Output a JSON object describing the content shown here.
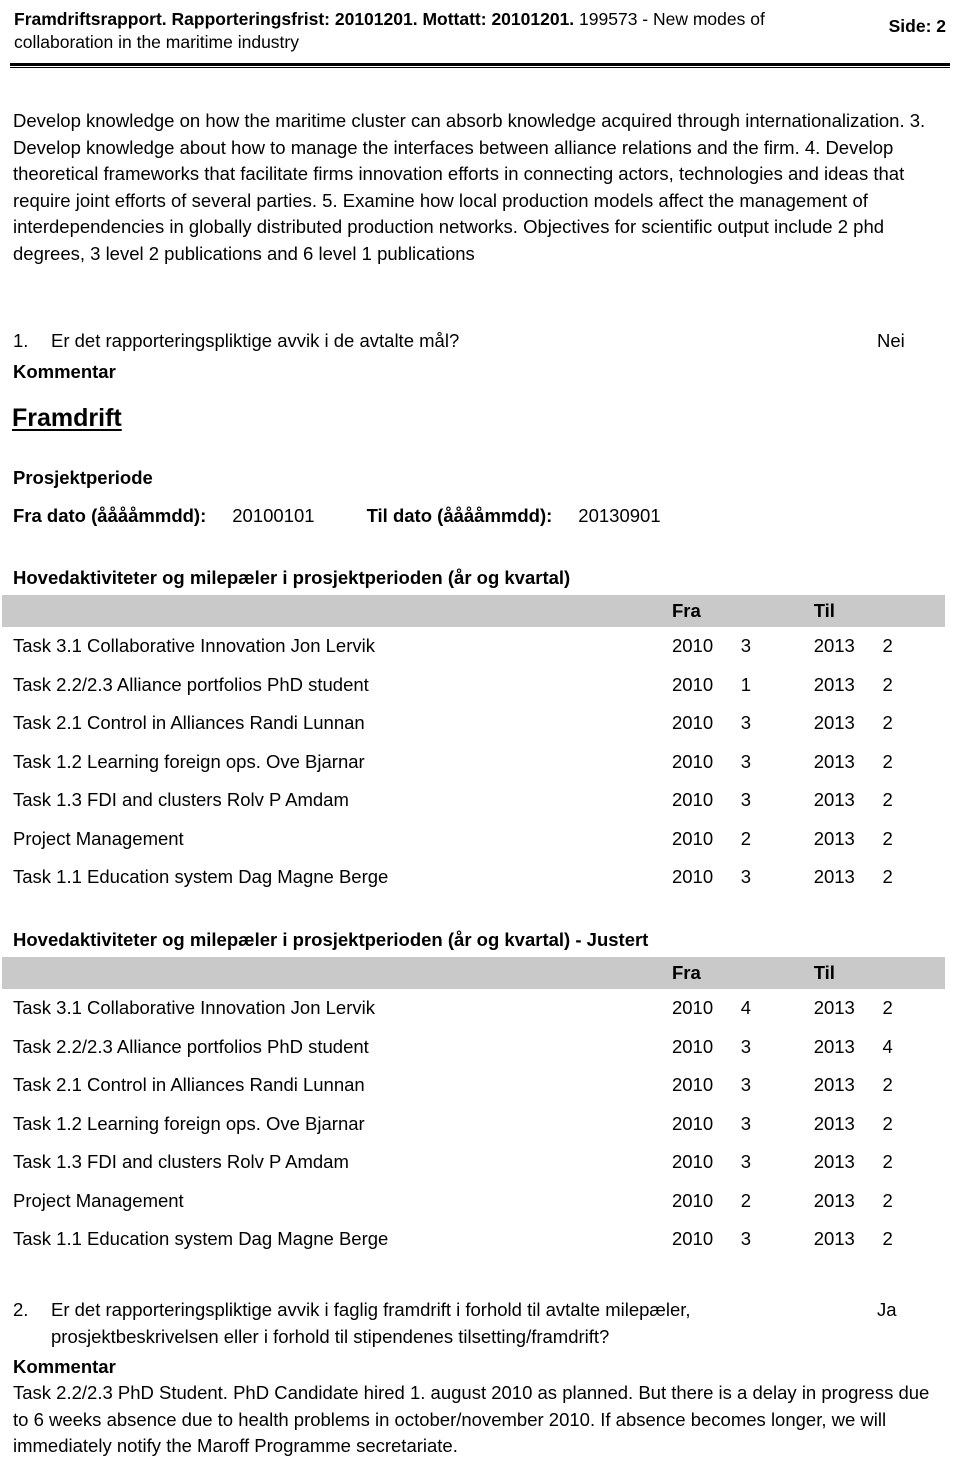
{
  "header": {
    "title_bold": "Framdriftsrapport. Rapporteringsfrist: 20101201. Mottatt: 20101201.",
    "title_normal": " 199573 - New modes of collaboration in the maritime industry",
    "page_label": "Side: 2"
  },
  "intro": {
    "text": "Develop knowledge on how the maritime cluster can absorb knowledge acquired through internationalization. 3. Develop knowledge about how to manage the interfaces between alliance relations and the firm. 4. Develop theoretical frameworks that facilitate firms innovation efforts in connecting actors, technologies and ideas that require joint efforts of several parties. 5. Examine how local production models affect the management of interdependencies in globally distributed production networks. Objectives for scientific output include 2 phd degrees, 3 level 2 publications and 6 level 1 publications"
  },
  "question1": {
    "number": "1.",
    "text": "Er det rapporteringspliktige avvik i de avtalte mål?",
    "answer": "Nei",
    "comment_label": "Kommentar",
    "comment_text": ""
  },
  "section": {
    "title": "Framdrift",
    "subsection_title": "Prosjektperiode",
    "from_date_label": "Fra dato (ååååmmdd):",
    "from_date_value": "20100101",
    "to_date_label": "Til dato (ååååmmdd):",
    "to_date_value": "20130901"
  },
  "tables": [
    {
      "caption": "Hovedaktiviteter og milepæler i prosjektperioden (år og kvartal)",
      "columns": [
        "",
        "Fra",
        "",
        "Til",
        ""
      ],
      "rows": [
        {
          "name": "Task 3.1 Collaborative Innovation Jon Lervik",
          "from_year": "2010",
          "from_q": "3",
          "to_year": "2013",
          "to_q": "2"
        },
        {
          "name": "Task 2.2/2.3 Alliance portfolios PhD student",
          "from_year": "2010",
          "from_q": "1",
          "to_year": "2013",
          "to_q": "2"
        },
        {
          "name": "Task 2.1 Control in Alliances Randi Lunnan",
          "from_year": "2010",
          "from_q": "3",
          "to_year": "2013",
          "to_q": "2"
        },
        {
          "name": "Task 1.2 Learning foreign ops. Ove Bjarnar",
          "from_year": "2010",
          "from_q": "3",
          "to_year": "2013",
          "to_q": "2"
        },
        {
          "name": "Task 1.3 FDI and clusters Rolv P Amdam",
          "from_year": "2010",
          "from_q": "3",
          "to_year": "2013",
          "to_q": "2"
        },
        {
          "name": "Project Management",
          "from_year": "2010",
          "from_q": "2",
          "to_year": "2013",
          "to_q": "2"
        },
        {
          "name": "Task 1.1 Education system Dag Magne Berge",
          "from_year": "2010",
          "from_q": "3",
          "to_year": "2013",
          "to_q": "2"
        }
      ]
    },
    {
      "caption": "Hovedaktiviteter og milepæler i prosjektperioden (år og kvartal) - Justert",
      "columns": [
        "",
        "Fra",
        "",
        "Til",
        ""
      ],
      "rows": [
        {
          "name": "Task 3.1 Collaborative Innovation Jon Lervik",
          "from_year": "2010",
          "from_q": "4",
          "to_year": "2013",
          "to_q": "2"
        },
        {
          "name": "Task 2.2/2.3 Alliance portfolios PhD student",
          "from_year": "2010",
          "from_q": "3",
          "to_year": "2013",
          "to_q": "4"
        },
        {
          "name": "Task 2.1 Control in Alliances Randi Lunnan",
          "from_year": "2010",
          "from_q": "3",
          "to_year": "2013",
          "to_q": "2"
        },
        {
          "name": "Task 1.2 Learning foreign ops. Ove Bjarnar",
          "from_year": "2010",
          "from_q": "3",
          "to_year": "2013",
          "to_q": "2"
        },
        {
          "name": "Task 1.3 FDI and clusters Rolv P Amdam",
          "from_year": "2010",
          "from_q": "3",
          "to_year": "2013",
          "to_q": "2"
        },
        {
          "name": "Project Management",
          "from_year": "2010",
          "from_q": "2",
          "to_year": "2013",
          "to_q": "2"
        },
        {
          "name": "Task 1.1 Education system Dag Magne Berge",
          "from_year": "2010",
          "from_q": "3",
          "to_year": "2013",
          "to_q": "2"
        }
      ]
    }
  ],
  "question2": {
    "number": "2.",
    "text": "Er det rapporteringspliktige avvik i faglig framdrift i forhold til avtalte milepæler, prosjektbeskrivelsen eller i forhold til stipendenes tilsetting/framdrift?",
    "answer": "Ja",
    "comment_label": "Kommentar",
    "comment_text": "Task 2.2/2.3 PhD Student. PhD Candidate hired 1. august 2010 as planned. But there is a delay in progress due to 6 weeks absence due to health problems in october/november 2010. If absence becomes longer, we will immediately notify the Maroff Programme secretariate."
  },
  "colors": {
    "table_header_bg": "#c9c9c9",
    "text": "#000000",
    "page_bg": "#ffffff"
  }
}
